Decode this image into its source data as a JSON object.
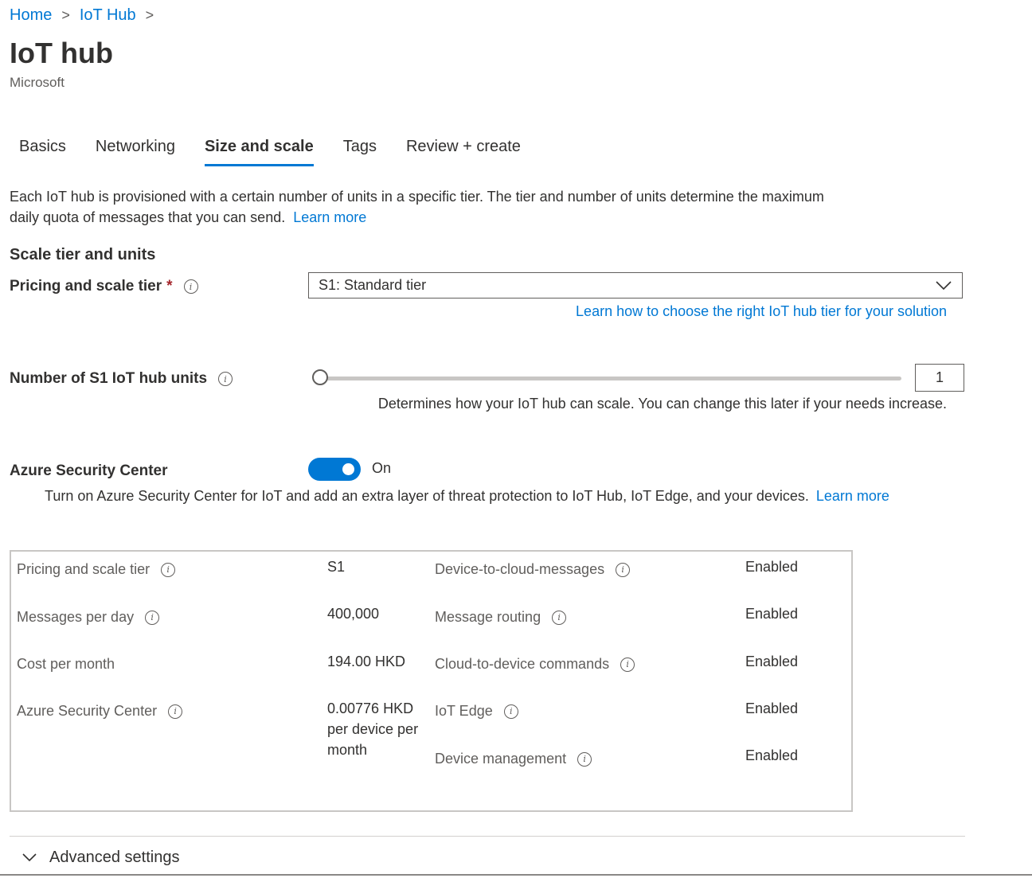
{
  "breadcrumb": {
    "home": "Home",
    "iot_hub": "IoT Hub",
    "separator": ">"
  },
  "page": {
    "title": "IoT hub",
    "subtitle": "Microsoft"
  },
  "tabs": [
    {
      "label": "Basics"
    },
    {
      "label": "Networking"
    },
    {
      "label": "Size and scale",
      "active": true
    },
    {
      "label": "Tags"
    },
    {
      "label": "Review + create"
    }
  ],
  "intro": {
    "text": "Each IoT hub is provisioned with a certain number of units in a specific tier. The tier and number of units determine the maximum daily quota of messages that you can send.",
    "learn_more": "Learn more"
  },
  "scale": {
    "heading": "Scale tier and units",
    "pricing_label": "Pricing and scale tier",
    "required_mark": "*",
    "pricing_value": "S1: Standard tier",
    "tier_link": "Learn how to choose the right IoT hub tier for your solution",
    "units_label": "Number of S1 IoT hub units",
    "units_value": "1",
    "units_slider_fraction": 0,
    "units_help": "Determines how your IoT hub can scale. You can change this later if your needs increase."
  },
  "security": {
    "label": "Azure Security Center",
    "toggle_state": "On",
    "description": "Turn on Azure Security Center for IoT and add an extra layer of threat protection to IoT Hub, IoT Edge, and your devices.",
    "learn_more": "Learn more"
  },
  "summary": {
    "left": [
      {
        "label": "Pricing and scale tier",
        "value": "S1",
        "info": true
      },
      {
        "label": "Messages per day",
        "value": "400,000",
        "info": true
      },
      {
        "label": "Cost per month",
        "value": "194.00 HKD",
        "info": false
      },
      {
        "label": "Azure Security Center",
        "value": "0.00776 HKD per device per month",
        "info": true
      }
    ],
    "right": [
      {
        "label": "Device-to-cloud-messages",
        "value": "Enabled"
      },
      {
        "label": "Message routing",
        "value": "Enabled"
      },
      {
        "label": "Cloud-to-device commands",
        "value": "Enabled"
      },
      {
        "label": "IoT Edge",
        "value": "Enabled"
      },
      {
        "label": "Device management",
        "value": "Enabled"
      }
    ]
  },
  "advanced": {
    "label": "Advanced settings"
  },
  "colors": {
    "accent": "#0078d4",
    "required": "#a4262c",
    "border": "#605e5c"
  },
  "icons": [
    "chevron-right-icon",
    "info-icon",
    "chevron-down-icon"
  ]
}
